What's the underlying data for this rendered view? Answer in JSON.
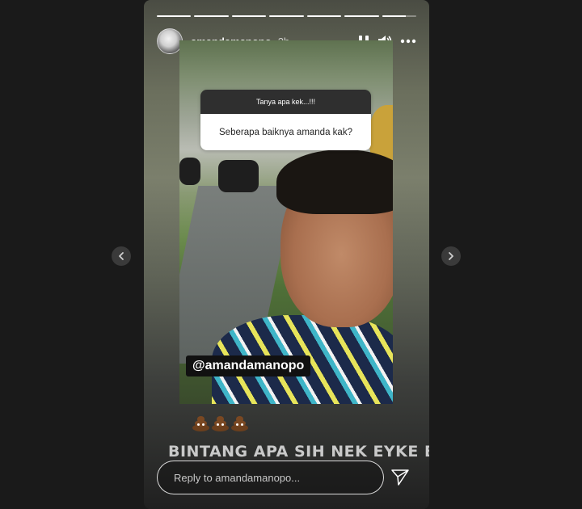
{
  "story": {
    "username": "amandamanopo",
    "time": "2h",
    "progress_segments": [
      1,
      1,
      1,
      1,
      1,
      1,
      0.7
    ],
    "question_sticker": {
      "title": "Tanya apa kek...!!!",
      "text": "Seberapa baiknya amanda  kak?"
    },
    "mention": "@amandamanopo",
    "emojis": [
      "pile-of-poo",
      "pile-of-poo",
      "pile-of-poo"
    ],
    "caption": "BINTANG APA SIH NEK EYKE BINGUNG"
  },
  "controls": {
    "pause_icon": "pause-icon",
    "volume_icon": "volume-icon",
    "more_icon": "more-icon"
  },
  "reply": {
    "placeholder": "Reply to amandamanopo..."
  },
  "navigation": {
    "prev_icon": "chevron-left-icon",
    "next_icon": "chevron-right-icon"
  }
}
